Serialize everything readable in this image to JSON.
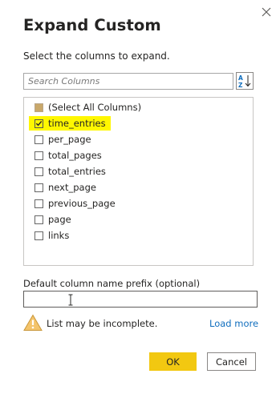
{
  "dialog": {
    "title": "Expand Custom",
    "subtitle": "Select the columns to expand.",
    "close_icon": "close-icon"
  },
  "search": {
    "placeholder": "Search Columns",
    "value": "",
    "sort_icon": "sort-az-icon"
  },
  "columns": {
    "select_all": {
      "label": "(Select All Columns)",
      "state": "partial"
    },
    "items": [
      {
        "label": "time_entries",
        "checked": true,
        "highlighted": true
      },
      {
        "label": "per_page",
        "checked": false
      },
      {
        "label": "total_pages",
        "checked": false
      },
      {
        "label": "total_entries",
        "checked": false
      },
      {
        "label": "next_page",
        "checked": false
      },
      {
        "label": "previous_page",
        "checked": false
      },
      {
        "label": "page",
        "checked": false
      },
      {
        "label": "links",
        "checked": false
      }
    ]
  },
  "prefix": {
    "label": "Default column name prefix (optional)",
    "value": ""
  },
  "warning": {
    "text": "List may be incomplete.",
    "link": "Load more",
    "icon": "warning-icon"
  },
  "buttons": {
    "ok": "OK",
    "cancel": "Cancel"
  },
  "colors": {
    "accent": "#f2c811",
    "highlight": "#fff700",
    "link": "#106ebe",
    "warning": "#f4c46b"
  }
}
